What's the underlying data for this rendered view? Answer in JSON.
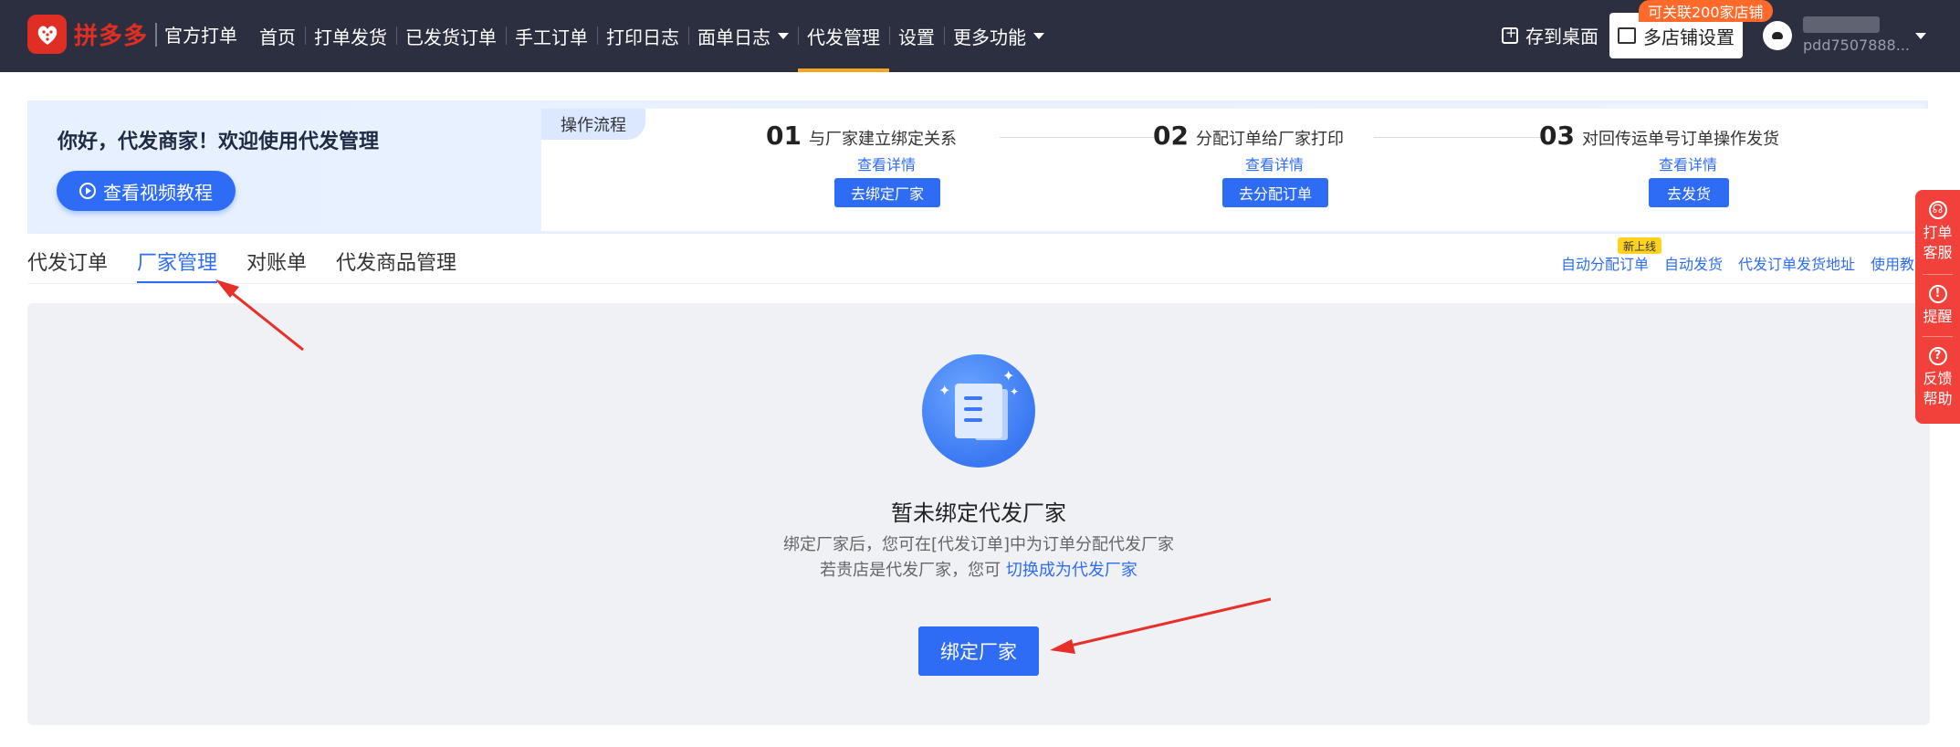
{
  "brand": {
    "logo_text": "拼多多",
    "sub_title": "官方打单",
    "logo_icon": "pinduoduo-logo-icon"
  },
  "nav": {
    "items": [
      {
        "label": "首页"
      },
      {
        "label": "打单发货"
      },
      {
        "label": "已发货订单"
      },
      {
        "label": "手工订单"
      },
      {
        "label": "打印日志"
      },
      {
        "label": "面单日志"
      },
      {
        "label": "代发管理"
      },
      {
        "label": "设置"
      },
      {
        "label": "更多功能"
      }
    ],
    "active": "代发管理"
  },
  "header_right": {
    "save_desktop": "存到桌面",
    "shop_settings": "多店铺设置",
    "shop_badge": "可关联200家店铺",
    "user_id": "pdd7507888..."
  },
  "banner": {
    "greeting": "你好，代发商家！欢迎使用代发管理",
    "video_button": "查看视频教程",
    "flow_tag": "操作流程",
    "steps": [
      {
        "num": "01",
        "title": "与厂家建立绑定关系",
        "detail": "查看详情",
        "button": "去绑定厂家"
      },
      {
        "num": "02",
        "title": "分配订单给厂家打印",
        "detail": "查看详情",
        "button": "去分配订单"
      },
      {
        "num": "03",
        "title": "对回传运单号订单操作发货",
        "detail": "查看详情",
        "button": "去发货"
      }
    ]
  },
  "tabs": {
    "items": [
      {
        "label": "代发订单"
      },
      {
        "label": "厂家管理"
      },
      {
        "label": "对账单"
      },
      {
        "label": "代发商品管理"
      }
    ],
    "active": "厂家管理"
  },
  "quick_links": {
    "new_badge": "新上线",
    "items": [
      "自动分配订单",
      "自动发货",
      "代发订单发货地址",
      "使用教"
    ]
  },
  "empty_state": {
    "title": "暂未绑定代发厂家",
    "desc1": "绑定厂家后，您可在[代发订单]中为订单分配代发厂家",
    "desc2_prefix": "若贵店是代发厂家，您可 ",
    "desc2_link": "切换成为代发厂家",
    "bind_button": "绑定厂家"
  },
  "float_panel": {
    "items": [
      {
        "label1": "打单",
        "label2": "客服",
        "icon": "headset-icon"
      },
      {
        "label1": "提醒",
        "label2": "",
        "icon": "alert-icon"
      },
      {
        "label1": "反馈",
        "label2": "帮助",
        "icon": "help-icon"
      }
    ]
  },
  "colors": {
    "nav_bg": "#2c2f3f",
    "primary": "#2f6cf5",
    "brand_red": "#e02e24",
    "active_underline": "#f5a623",
    "float_red": "#f2403a",
    "annotation_red": "#e8302a"
  }
}
